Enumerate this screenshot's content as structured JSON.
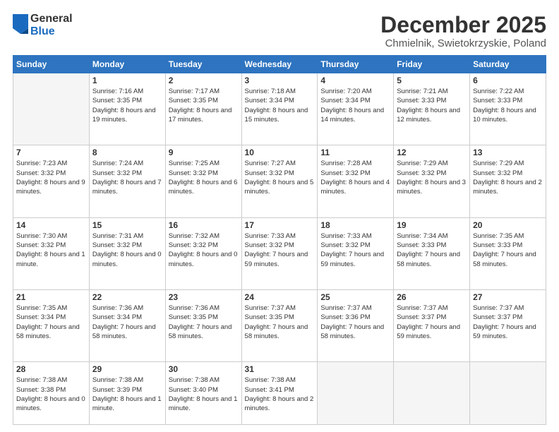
{
  "logo": {
    "general": "General",
    "blue": "Blue"
  },
  "header": {
    "month": "December 2025",
    "location": "Chmielnik, Swietokrzyskie, Poland"
  },
  "days_of_week": [
    "Sunday",
    "Monday",
    "Tuesday",
    "Wednesday",
    "Thursday",
    "Friday",
    "Saturday"
  ],
  "weeks": [
    [
      {
        "day": "",
        "empty": true
      },
      {
        "day": "1",
        "sunrise": "7:16 AM",
        "sunset": "3:35 PM",
        "daylight": "8 hours and 19 minutes."
      },
      {
        "day": "2",
        "sunrise": "7:17 AM",
        "sunset": "3:35 PM",
        "daylight": "8 hours and 17 minutes."
      },
      {
        "day": "3",
        "sunrise": "7:18 AM",
        "sunset": "3:34 PM",
        "daylight": "8 hours and 15 minutes."
      },
      {
        "day": "4",
        "sunrise": "7:20 AM",
        "sunset": "3:34 PM",
        "daylight": "8 hours and 14 minutes."
      },
      {
        "day": "5",
        "sunrise": "7:21 AM",
        "sunset": "3:33 PM",
        "daylight": "8 hours and 12 minutes."
      },
      {
        "day": "6",
        "sunrise": "7:22 AM",
        "sunset": "3:33 PM",
        "daylight": "8 hours and 10 minutes."
      }
    ],
    [
      {
        "day": "7",
        "sunrise": "7:23 AM",
        "sunset": "3:32 PM",
        "daylight": "8 hours and 9 minutes."
      },
      {
        "day": "8",
        "sunrise": "7:24 AM",
        "sunset": "3:32 PM",
        "daylight": "8 hours and 7 minutes."
      },
      {
        "day": "9",
        "sunrise": "7:25 AM",
        "sunset": "3:32 PM",
        "daylight": "8 hours and 6 minutes."
      },
      {
        "day": "10",
        "sunrise": "7:27 AM",
        "sunset": "3:32 PM",
        "daylight": "8 hours and 5 minutes."
      },
      {
        "day": "11",
        "sunrise": "7:28 AM",
        "sunset": "3:32 PM",
        "daylight": "8 hours and 4 minutes."
      },
      {
        "day": "12",
        "sunrise": "7:29 AM",
        "sunset": "3:32 PM",
        "daylight": "8 hours and 3 minutes."
      },
      {
        "day": "13",
        "sunrise": "7:29 AM",
        "sunset": "3:32 PM",
        "daylight": "8 hours and 2 minutes."
      }
    ],
    [
      {
        "day": "14",
        "sunrise": "7:30 AM",
        "sunset": "3:32 PM",
        "daylight": "8 hours and 1 minute."
      },
      {
        "day": "15",
        "sunrise": "7:31 AM",
        "sunset": "3:32 PM",
        "daylight": "8 hours and 0 minutes."
      },
      {
        "day": "16",
        "sunrise": "7:32 AM",
        "sunset": "3:32 PM",
        "daylight": "8 hours and 0 minutes."
      },
      {
        "day": "17",
        "sunrise": "7:33 AM",
        "sunset": "3:32 PM",
        "daylight": "7 hours and 59 minutes."
      },
      {
        "day": "18",
        "sunrise": "7:33 AM",
        "sunset": "3:32 PM",
        "daylight": "7 hours and 59 minutes."
      },
      {
        "day": "19",
        "sunrise": "7:34 AM",
        "sunset": "3:33 PM",
        "daylight": "7 hours and 58 minutes."
      },
      {
        "day": "20",
        "sunrise": "7:35 AM",
        "sunset": "3:33 PM",
        "daylight": "7 hours and 58 minutes."
      }
    ],
    [
      {
        "day": "21",
        "sunrise": "7:35 AM",
        "sunset": "3:34 PM",
        "daylight": "7 hours and 58 minutes."
      },
      {
        "day": "22",
        "sunrise": "7:36 AM",
        "sunset": "3:34 PM",
        "daylight": "7 hours and 58 minutes."
      },
      {
        "day": "23",
        "sunrise": "7:36 AM",
        "sunset": "3:35 PM",
        "daylight": "7 hours and 58 minutes."
      },
      {
        "day": "24",
        "sunrise": "7:37 AM",
        "sunset": "3:35 PM",
        "daylight": "7 hours and 58 minutes."
      },
      {
        "day": "25",
        "sunrise": "7:37 AM",
        "sunset": "3:36 PM",
        "daylight": "7 hours and 58 minutes."
      },
      {
        "day": "26",
        "sunrise": "7:37 AM",
        "sunset": "3:37 PM",
        "daylight": "7 hours and 59 minutes."
      },
      {
        "day": "27",
        "sunrise": "7:37 AM",
        "sunset": "3:37 PM",
        "daylight": "7 hours and 59 minutes."
      }
    ],
    [
      {
        "day": "28",
        "sunrise": "7:38 AM",
        "sunset": "3:38 PM",
        "daylight": "8 hours and 0 minutes."
      },
      {
        "day": "29",
        "sunrise": "7:38 AM",
        "sunset": "3:39 PM",
        "daylight": "8 hours and 1 minute."
      },
      {
        "day": "30",
        "sunrise": "7:38 AM",
        "sunset": "3:40 PM",
        "daylight": "8 hours and 1 minute."
      },
      {
        "day": "31",
        "sunrise": "7:38 AM",
        "sunset": "3:41 PM",
        "daylight": "8 hours and 2 minutes."
      },
      {
        "day": "",
        "empty": true
      },
      {
        "day": "",
        "empty": true
      },
      {
        "day": "",
        "empty": true
      }
    ]
  ]
}
